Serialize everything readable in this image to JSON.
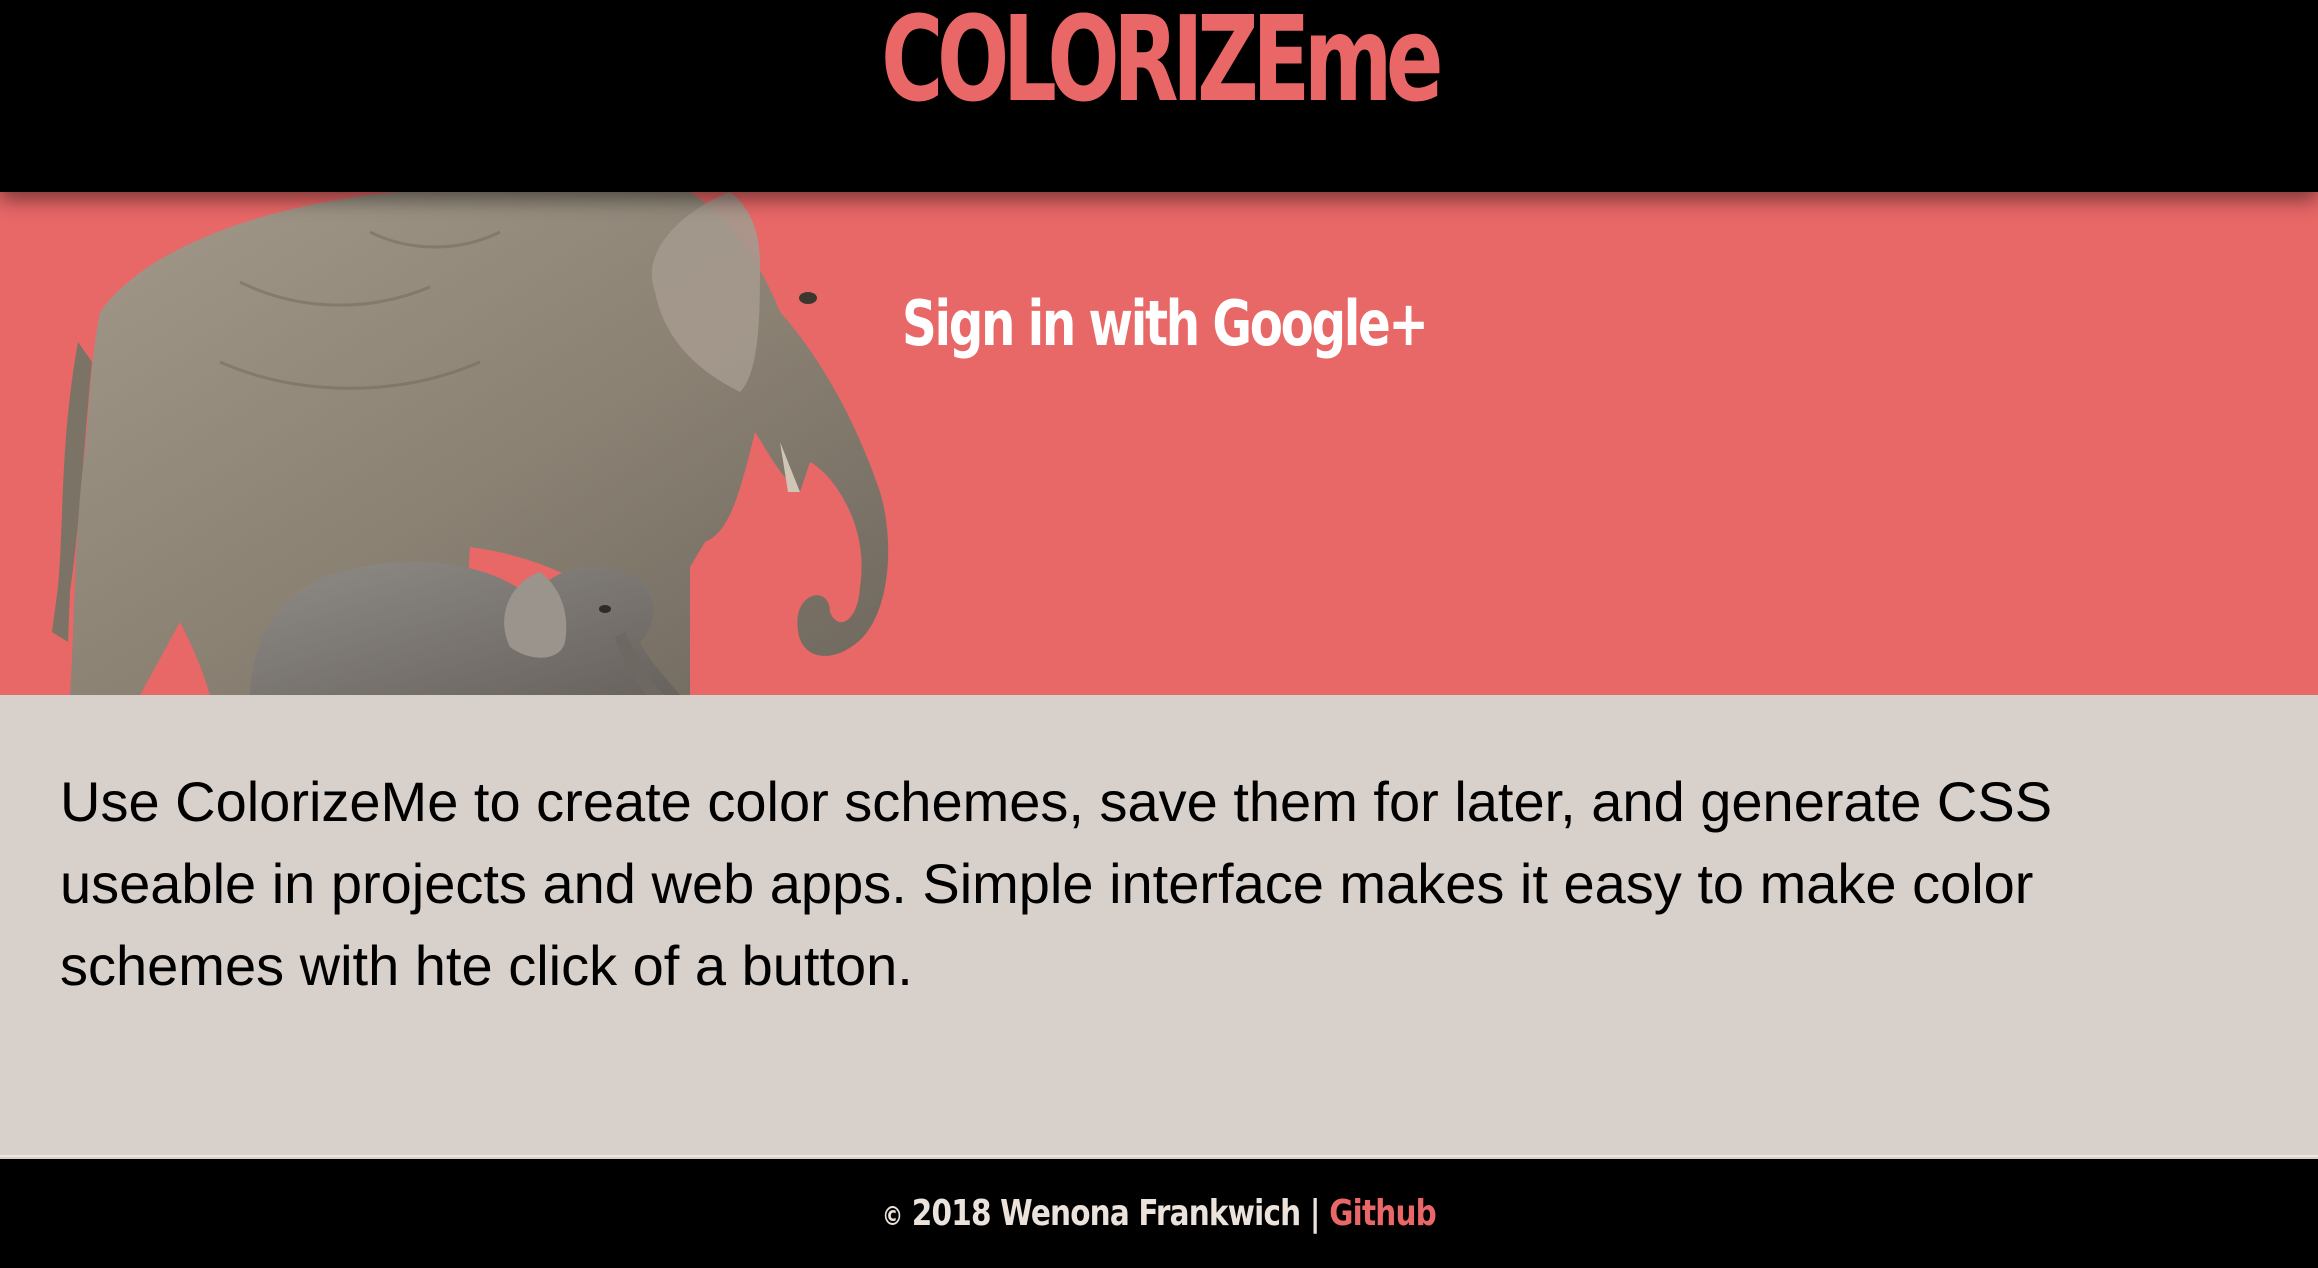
{
  "header": {
    "brand": "COLORIZEme"
  },
  "hero": {
    "image_alt": "elephant and calf",
    "signin_label": "Sign in with Google+"
  },
  "about": {
    "text": "Use ColorizeMe to create color schemes, save them for later, and generate CSS useable in projects and web apps. Simple interface makes it easy to make color schemes with hte click of a button."
  },
  "footer": {
    "copyright_symbol": "©",
    "copyright_text": "2018 Wenona Frankwich |",
    "link_label": "Github"
  },
  "colors": {
    "accent": "#e96767",
    "hero_background": "#e86767",
    "body_background": "#d8d0cb",
    "header_background": "#000000",
    "footer_text": "#ebe2dc"
  }
}
